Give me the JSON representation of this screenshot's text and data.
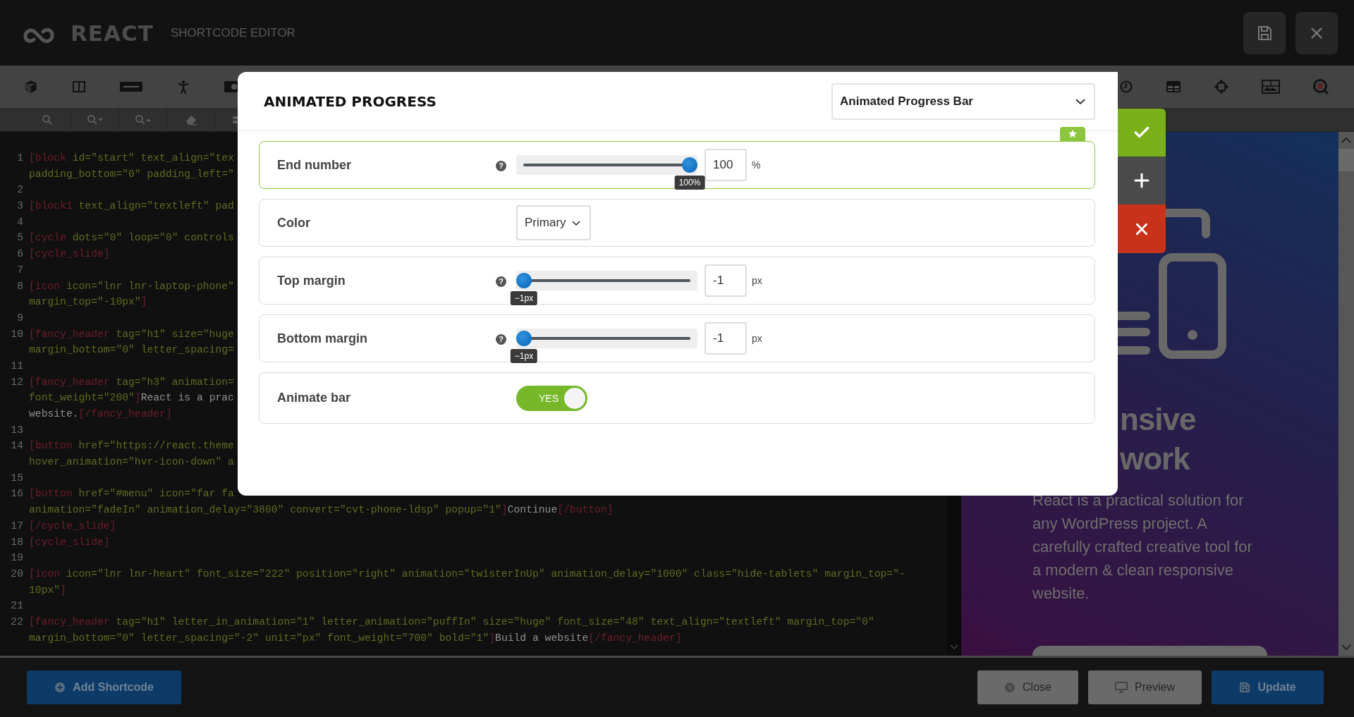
{
  "header": {
    "logo": "REACT",
    "subtitle": "SHORTCODE EDITOR"
  },
  "code": {
    "lines": [
      {
        "num": "1",
        "rows": [
          {
            "parts": [
              {
                "kind": "tag",
                "text": "[block"
              },
              {
                "kind": "attr",
                "text": " id=\"start\" text_align=\"tex"
              }
            ]
          },
          {
            "parts": [
              {
                "kind": "attr",
                "text": "padding_bottom=\"0\" padding_left=\""
              }
            ]
          }
        ]
      },
      {
        "num": "2"
      },
      {
        "num": "3",
        "rows": [
          {
            "parts": [
              {
                "kind": "tag",
                "text": "[block1"
              },
              {
                "kind": "attr",
                "text": " text_align=\"textleft\" pad"
              }
            ]
          }
        ]
      },
      {
        "num": "4"
      },
      {
        "num": "5",
        "rows": [
          {
            "parts": [
              {
                "kind": "tag",
                "text": "[cycle"
              },
              {
                "kind": "attr",
                "text": " dots=\"0\" loop=\"0\" controls"
              }
            ]
          }
        ]
      },
      {
        "num": "6",
        "rows": [
          {
            "parts": [
              {
                "kind": "tag",
                "text": "[cycle_slide]"
              }
            ]
          }
        ]
      },
      {
        "num": "7"
      },
      {
        "num": "8",
        "rows": [
          {
            "parts": [
              {
                "kind": "tag",
                "text": "[icon"
              },
              {
                "kind": "attr",
                "text": " icon=\"lnr lnr-laptop-phone\""
              }
            ]
          },
          {
            "parts": [
              {
                "kind": "attr",
                "text": "margin_top=\"-10px\""
              },
              {
                "kind": "tag",
                "text": "]"
              }
            ]
          }
        ]
      },
      {
        "num": "9"
      },
      {
        "num": "10",
        "rows": [
          {
            "parts": [
              {
                "kind": "tag",
                "text": "[fancy_header"
              },
              {
                "kind": "attr",
                "text": " tag=\"h1\" size=\"huge"
              }
            ]
          },
          {
            "parts": [
              {
                "kind": "attr",
                "text": "margin_bottom=\"0\" letter_spacing="
              }
            ]
          }
        ]
      },
      {
        "num": "11"
      },
      {
        "num": "12",
        "rows": [
          {
            "parts": [
              {
                "kind": "tag",
                "text": "[fancy_header"
              },
              {
                "kind": "attr",
                "text": " tag=\"h3\" animation="
              }
            ]
          },
          {
            "parts": [
              {
                "kind": "attr",
                "text": "font_weight=\"200\""
              },
              {
                "kind": "tag",
                "text": "]"
              },
              {
                "kind": "text",
                "text": "React is a prac"
              }
            ]
          },
          {
            "parts": [
              {
                "kind": "text",
                "text": "website."
              },
              {
                "kind": "tag",
                "text": "[/fancy_header]"
              }
            ]
          }
        ]
      },
      {
        "num": "13"
      },
      {
        "num": "14",
        "rows": [
          {
            "parts": [
              {
                "kind": "tag",
                "text": "[button"
              },
              {
                "kind": "attr",
                "text": " href=\"https://react.theme"
              }
            ]
          },
          {
            "parts": [
              {
                "kind": "attr",
                "text": "hover_animation=\"hvr-icon-down\" a"
              }
            ]
          }
        ]
      },
      {
        "num": "15"
      },
      {
        "num": "16",
        "rows": [
          {
            "parts": [
              {
                "kind": "tag",
                "text": "[button"
              },
              {
                "kind": "attr",
                "text": " href=\"#menu\" icon=\"far fa"
              }
            ]
          },
          {
            "parts": [
              {
                "kind": "attr",
                "text": "animation=\"fadeIn\" animation_delay=\"3800\" convert=\"cvt-phone-ldsp\" popup=\"1\""
              },
              {
                "kind": "tag",
                "text": "]"
              },
              {
                "kind": "text",
                "text": "Continue"
              },
              {
                "kind": "tag",
                "text": "[/button]"
              }
            ]
          }
        ]
      },
      {
        "num": "17",
        "rows": [
          {
            "parts": [
              {
                "kind": "tag",
                "text": "[/cycle_slide]"
              }
            ]
          }
        ]
      },
      {
        "num": "18",
        "rows": [
          {
            "parts": [
              {
                "kind": "tag",
                "text": "[cycle_slide]"
              }
            ]
          }
        ]
      },
      {
        "num": "19"
      },
      {
        "num": "20",
        "rows": [
          {
            "parts": [
              {
                "kind": "tag",
                "text": "[icon"
              },
              {
                "kind": "attr",
                "text": " icon=\"lnr lnr-heart\" font_size=\"222\" position=\"right\" animation=\"twisterInUp\" animation_delay=\"1000\" class=\"hide-tablets\" margin_top=\"-"
              }
            ]
          },
          {
            "parts": [
              {
                "kind": "attr",
                "text": "10px\""
              },
              {
                "kind": "tag",
                "text": "]"
              }
            ]
          }
        ]
      },
      {
        "num": "21"
      },
      {
        "num": "22",
        "rows": [
          {
            "parts": [
              {
                "kind": "tag",
                "text": "[fancy_header"
              },
              {
                "kind": "attr",
                "text": " tag=\"h1\" letter_in_animation=\"1\" letter_animation=\"puffIn\" size=\"huge\" font_size=\"48\" text_align=\"textleft\" margin_top=\"0\""
              }
            ]
          },
          {
            "parts": [
              {
                "kind": "attr",
                "text": "margin_bottom=\"0\" letter_spacing=\"-2\" unit=\"px\" font_weight=\"700\" bold=\"1\""
              },
              {
                "kind": "tag",
                "text": "]"
              },
              {
                "kind": "text",
                "text": "Build a website"
              },
              {
                "kind": "tag",
                "text": "[/fancy_header]"
              }
            ]
          }
        ]
      }
    ]
  },
  "preview": {
    "heading_lines": [
      "nsive",
      "work"
    ],
    "paragraph": "React is a practical solution for any WordPress project. A carefully crafted creative tool for a modern & clean responsive website."
  },
  "modal": {
    "title": "ANIMATED PROGRESS",
    "preset": "Animated Progress Bar",
    "fields": [
      {
        "kind": "slider",
        "label": "End number",
        "help": "?",
        "highlighted": true,
        "level": 1,
        "value": "100",
        "unit": "%",
        "tooltip": "100%"
      },
      {
        "kind": "select",
        "label": "Color",
        "highlighted": false,
        "value": "Primary"
      },
      {
        "kind": "slider",
        "label": "Top margin",
        "help": "?",
        "highlighted": false,
        "level": 0,
        "value": "-1",
        "unit": "px",
        "tooltip": "−1px"
      },
      {
        "kind": "slider",
        "label": "Bottom margin",
        "help": "?",
        "highlighted": false,
        "level": 0,
        "value": "-1",
        "unit": "px",
        "tooltip": "−1px"
      },
      {
        "kind": "toggle",
        "label": "Animate bar",
        "highlighted": false,
        "on": true,
        "on_text": "YES"
      }
    ]
  },
  "footer": {
    "add_button": {
      "label": "Add Shortcode"
    },
    "buttons": [
      {
        "label": "Close",
        "disabled": true
      },
      {
        "label": "Preview",
        "disabled": true
      },
      {
        "label": "Update",
        "disabled": false
      }
    ]
  }
}
